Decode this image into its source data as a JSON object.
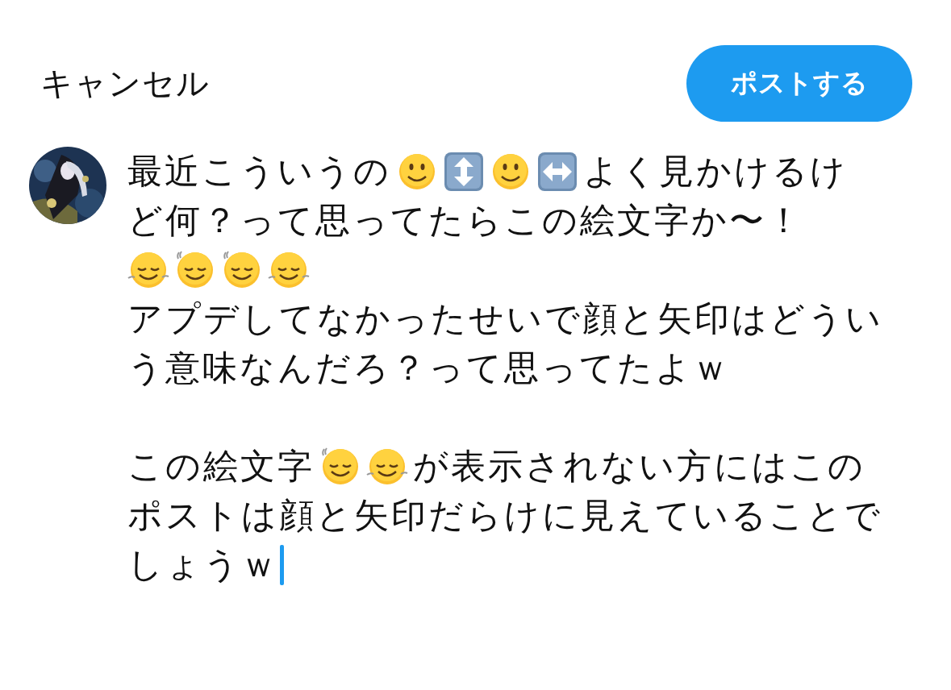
{
  "header": {
    "cancel": "キャンセル",
    "post_button": "ポストする"
  },
  "draft": {
    "cursor": true,
    "paragraphs": [
      [
        [
          {
            "kind": "text",
            "text": "最近こういうの"
          },
          {
            "kind": "smiley"
          },
          {
            "kind": "updown"
          },
          {
            "kind": "smiley"
          },
          {
            "kind": "leftright"
          },
          {
            "kind": "text",
            "text": "よく見かけるけ"
          }
        ],
        [
          {
            "kind": "text",
            "text": "ど何？って思ってたらこの絵文字か〜！"
          }
        ],
        [
          {
            "kind": "shaking"
          },
          {
            "kind": "nodding"
          },
          {
            "kind": "nodding"
          },
          {
            "kind": "shaking"
          }
        ],
        [
          {
            "kind": "text",
            "text": "アプデしてなかったせいで顔と矢印はどうい"
          }
        ],
        [
          {
            "kind": "text",
            "text": "う意味なんだろ？って思ってたよｗ"
          }
        ]
      ],
      [
        [
          {
            "kind": "text",
            "text": "この絵文字"
          },
          {
            "kind": "nodding"
          },
          {
            "kind": "shaking"
          },
          {
            "kind": "text",
            "text": "が表示されない方にはこの"
          }
        ],
        [
          {
            "kind": "text",
            "text": "ポストは顔と矢印だらけに見えていることで"
          }
        ],
        [
          {
            "kind": "text",
            "text": "しょうｗ"
          }
        ]
      ]
    ]
  }
}
